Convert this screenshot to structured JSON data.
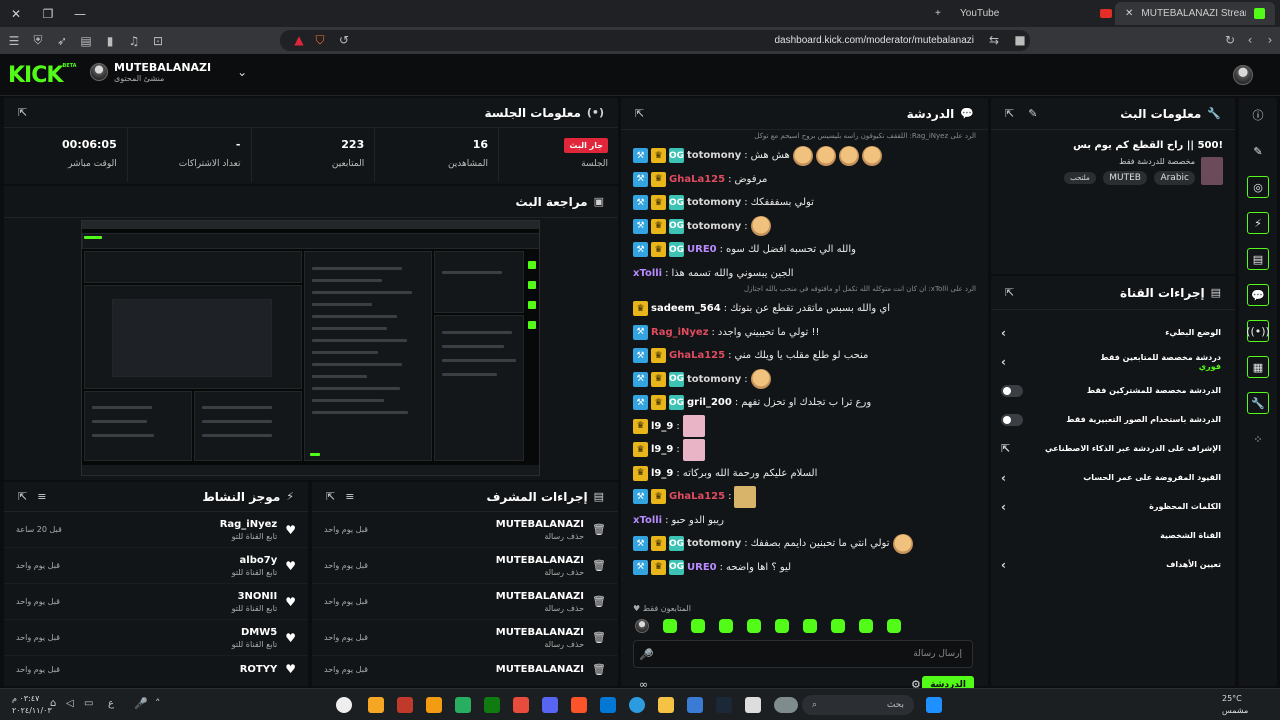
{
  "browser": {
    "tabs": [
      {
        "label": "YouTube",
        "active": false
      },
      {
        "label": "MUTEBALANAZI Stream - Kic",
        "active": true
      }
    ],
    "url": "dashboard.kick.com/moderator/mutebalanazi"
  },
  "header": {
    "logo": "KICK",
    "logo_badge": "BETA",
    "username": "MUTEBALANAZI",
    "role": "منشئ المحتوى"
  },
  "session": {
    "title": "معلومات الجلسة",
    "live_badge": "جار البث",
    "live_label": "الجلسة",
    "stats": [
      {
        "value": "16",
        "label": "المشاهدين"
      },
      {
        "value": "223",
        "label": "المتابعين"
      },
      {
        "value": "-",
        "label": "تعداد الاشتراكات"
      },
      {
        "value": "00:06:05",
        "label": "الوقت مباشر"
      }
    ]
  },
  "preview": {
    "title": "مراجعة البث"
  },
  "activity": {
    "title": "موجز النشاط",
    "items": [
      {
        "name": "Rag_iNyez",
        "action": "تابع القناة للتو",
        "time": "قبل 20 ساعة"
      },
      {
        "name": "albo7y",
        "action": "تابع القناة للتو",
        "time": "قبل يوم واحد"
      },
      {
        "name": "3NONII",
        "action": "تابع القناة للتو",
        "time": "قبل يوم واحد"
      },
      {
        "name": "DMW5",
        "action": "تابع القناة للتو",
        "time": "قبل يوم واحد"
      },
      {
        "name": "ROTYY",
        "action": "",
        "time": "قبل يوم واحد"
      }
    ]
  },
  "modactions": {
    "title": "إجراءات المشرف",
    "items": [
      {
        "name": "MUTEBALANAZI",
        "action": "حذف رسالة",
        "time": "قبل يوم واحد"
      },
      {
        "name": "MUTEBALANAZI",
        "action": "حذف رسالة",
        "time": "قبل يوم واحد"
      },
      {
        "name": "MUTEBALANAZI",
        "action": "حذف رسالة",
        "time": "قبل يوم واحد"
      },
      {
        "name": "MUTEBALANAZI",
        "action": "حذف رسالة",
        "time": "قبل يوم واحد"
      },
      {
        "name": "MUTEBALANAZI",
        "action": "",
        "time": "قبل يوم واحد"
      }
    ]
  },
  "chat": {
    "title": "الدردشة",
    "reply_line_1": "الرد على Rag_iNyez: اللققف نكبوفون راسه بليسيس بروح اسيحم مع توكل",
    "reply_line_2": "الرد على xTolli: ان كان انت متوكله الله تكمل او مافتوفه في منحب بالله اجتازل",
    "messages": [
      {
        "user": "totomony",
        "color": "#d7d7d7",
        "text": "هش هش",
        "badges": [
          "mod",
          "vip",
          "og"
        ],
        "extra": "emotes"
      },
      {
        "user": "GhaLa125",
        "color": "#e04b5f",
        "text": "مرفوض",
        "badges": [
          "mod",
          "vip"
        ]
      },
      {
        "user": "totomony",
        "color": "#d7d7d7",
        "text": "تولي بسفففكك",
        "badges": [
          "mod",
          "vip",
          "og"
        ]
      },
      {
        "user": "totomony",
        "color": "#d7d7d7",
        "text": "",
        "badges": [
          "mod",
          "vip",
          "og"
        ],
        "extra": "emote"
      },
      {
        "user": "URE0",
        "color": "#b98bff",
        "text": "والله الي تحسبه افضل لك سوه",
        "badges": [
          "mod",
          "vip",
          "og"
        ]
      },
      {
        "user": "xTolli",
        "color": "#b98bff",
        "text": "الجين يبسوني والله تسمه هذا",
        "badges": []
      },
      {
        "user": "sadeem_564",
        "color": "#ffffff",
        "text": "اي والله بسبس ماتقدر تقطع عن بتوتك",
        "badges": [
          "vip"
        ]
      },
      {
        "user": "Rag_iNyez",
        "color": "#e04b5f",
        "text": "!! تولي ما تحيبيني واجدد",
        "badges": [
          "mod"
        ]
      },
      {
        "user": "GhaLa125",
        "color": "#e04b5f",
        "text": "منحب لو طلع مقلب يا ويلك مني",
        "badges": [
          "mod",
          "vip"
        ]
      },
      {
        "user": "totomony",
        "color": "#d7d7d7",
        "text": "",
        "badges": [
          "mod",
          "vip",
          "og"
        ],
        "extra": "emote"
      },
      {
        "user": "gril_200",
        "color": "#ffffff",
        "text": "ورع ترا ب تجلدك او تحزل تفهم",
        "badges": [
          "mod",
          "vip",
          "og"
        ]
      },
      {
        "user": "l9_9",
        "color": "#ffffff",
        "text": "",
        "badges": [
          "vip"
        ],
        "extra": "sticker"
      },
      {
        "user": "l9_9",
        "color": "#ffffff",
        "text": "",
        "badges": [
          "vip"
        ],
        "extra": "sticker"
      },
      {
        "user": "l9_9",
        "color": "#ffffff",
        "text": "السلام عليكم ورحمة الله وبركاته",
        "badges": [
          "vip"
        ]
      },
      {
        "user": "GhaLa125",
        "color": "#e04b5f",
        "text": "",
        "badges": [
          "mod",
          "vip"
        ],
        "extra": "sticker2"
      },
      {
        "user": "xTolli",
        "color": "#b98bff",
        "text": "ريبو الدو حبو",
        "badges": []
      },
      {
        "user": "totomony",
        "color": "#d7d7d7",
        "text": "تولي انتي ما تحبنين دايمم بصففك",
        "badges": [
          "mod",
          "vip",
          "og"
        ],
        "extra": "emote"
      },
      {
        "user": "URE0",
        "color": "#b98bff",
        "text": "ليو ؟ اها واضحه",
        "badges": [
          "mod",
          "vip",
          "og"
        ]
      }
    ],
    "followers_only_label": "المتابعون فقط",
    "input_placeholder": "إرسال رسالة",
    "send_label": "الدردشة"
  },
  "stream_info": {
    "title": "معلومات البث",
    "stream_title": "!500 || راح القطع كم يوم بس",
    "category": "مخصصة للدردشة فقط",
    "tags": [
      "Arabic",
      "MUTEB",
      "ملتحب"
    ]
  },
  "channel_actions": {
    "title": "إجراءات القناة",
    "options": [
      {
        "label": "الوضع البطيء",
        "sub": "",
        "control": "chevron"
      },
      {
        "label": "دردشة مخصصة للمتابعين فقط",
        "sub": "فوري",
        "control": "chevron"
      },
      {
        "label": "الدردشة مخصصة للمشتركين فقط",
        "sub": "",
        "control": "toggle"
      },
      {
        "label": "الدردشة باستخدام الصور التعبيرية فقط",
        "sub": "",
        "control": "toggle"
      },
      {
        "label": "الإشراف على الدردشة عبر الذكاء الاصطناعي",
        "sub": "",
        "control": "external"
      },
      {
        "label": "القيود المفروضة على عمر الحساب",
        "sub": "",
        "control": "chevron"
      },
      {
        "label": "الكلمات المحظورة",
        "sub": "",
        "control": "chevron"
      },
      {
        "label": "القناة الشخصية",
        "sub": "",
        "control": "none"
      },
      {
        "label": "تعيين الأهداف",
        "sub": "",
        "control": "chevron"
      }
    ]
  },
  "taskbar": {
    "time": "٠٣:٤٧ م",
    "date": "٢٠٢٤/١١/٠٣",
    "search_label": "بحث",
    "weather_temp": "25°C",
    "weather_desc": "مشمس"
  }
}
